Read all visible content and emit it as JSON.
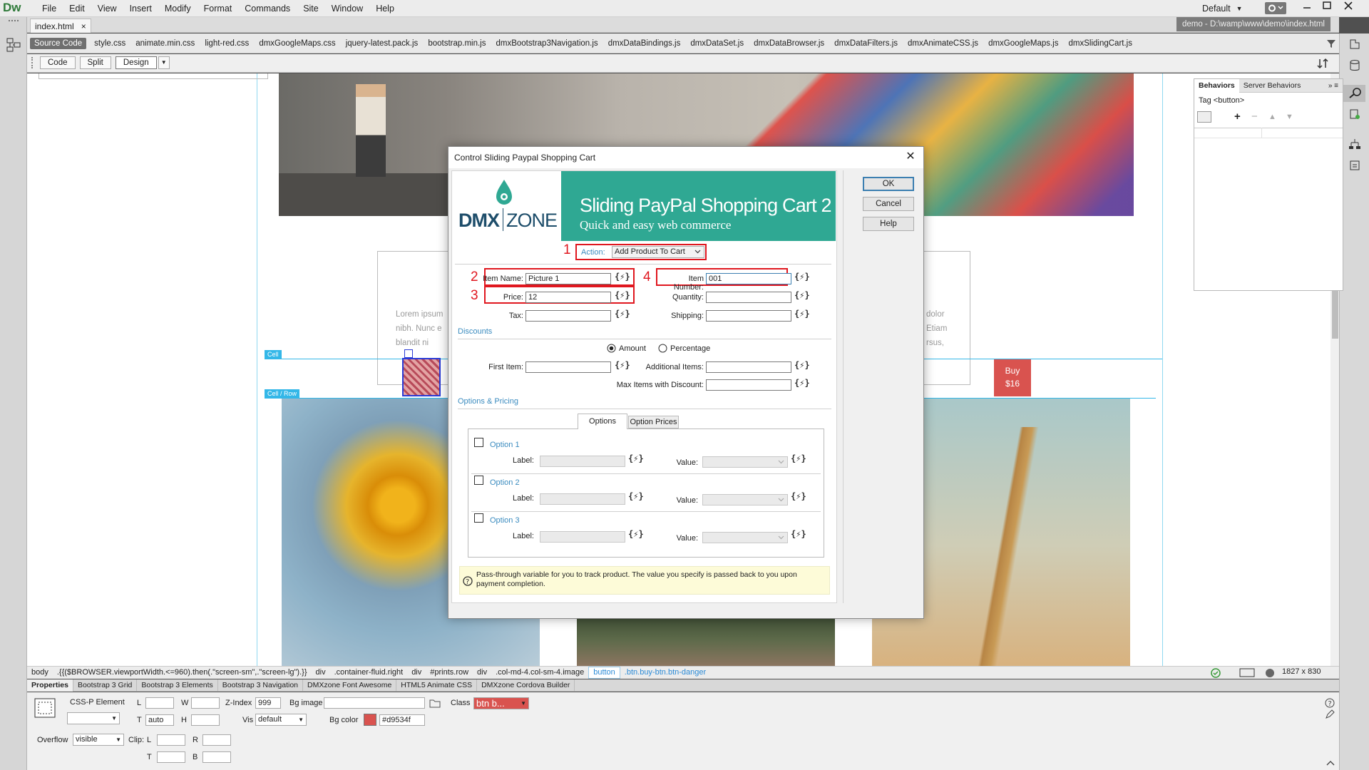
{
  "app": {
    "logo": "Dw",
    "menus": [
      "File",
      "Edit",
      "View",
      "Insert",
      "Modify",
      "Format",
      "Commands",
      "Site",
      "Window",
      "Help"
    ],
    "workspace": "Default",
    "document_path": "demo - D:\\wamp\\www\\demo\\index.html"
  },
  "doc_tab": {
    "label": "index.html",
    "close": "×"
  },
  "related_files": [
    "Source Code",
    "style.css",
    "animate.min.css",
    "light-red.css",
    "dmxGoogleMaps.css",
    "jquery-latest.pack.js",
    "bootstrap.min.js",
    "dmxBootstrap3Navigation.js",
    "dmxDataBindings.js",
    "dmxDataSet.js",
    "dmxDataBrowser.js",
    "dmxDataFilters.js",
    "dmxAnimateCSS.js",
    "dmxGoogleMaps.js",
    "dmxSlidingCart.js"
  ],
  "view_buttons": {
    "code": "Code",
    "split": "Split",
    "design": "Design"
  },
  "design": {
    "card_left_text": [
      "Lorem ipsum",
      "nibh. Nunc e",
      "blandit ni"
    ],
    "card_right_text": [
      "dolor",
      "Etiam",
      "rsus,"
    ],
    "buy_label": "Buy",
    "buy_price": "$16",
    "cell_badge": "Cell",
    "cell_row_badge": "Cell / Row"
  },
  "behaviors_panel": {
    "tabs": [
      "Behaviors",
      "Server Behaviors"
    ],
    "tag": "Tag <button>"
  },
  "status_bar": {
    "tags": [
      "body",
      ".{{($BROWSER.viewportWidth.<=960).then(.\"screen-sm\",.\"screen-lg\").}}",
      "div",
      ".container-fluid.right",
      "div",
      "#prints.row",
      "div",
      ".col-md-4.col-sm-4.image",
      "button",
      ".btn.buy-btn.btn-danger"
    ],
    "size": "1827 x 830"
  },
  "properties_tabs": [
    "Properties",
    "Bootstrap 3 Grid",
    "Bootstrap 3 Elements",
    "Bootstrap 3 Navigation",
    "DMXzone Font Awesome",
    "HTML5 Animate CSS",
    "DMXzone Cordova Builder"
  ],
  "properties": {
    "element_type": "CSS-P Element",
    "L": "L",
    "W": "W",
    "T": "T",
    "H": "H",
    "z_index_label": "Z-Index",
    "z_index": "999",
    "bg_image_label": "Bg image",
    "class_label": "Class",
    "class_value": "btn b...",
    "top_value": "auto",
    "vis_label": "Vis",
    "vis_value": "default",
    "bg_color_label": "Bg color",
    "bg_color_value": "#d9534f",
    "overflow_label": "Overflow",
    "overflow_value": "visible",
    "clip_label": "Clip:",
    "clip_L": "L",
    "clip_R": "R",
    "clip_T": "T",
    "clip_B": "B"
  },
  "dialog": {
    "title": "Control Sliding Paypal Shopping Cart",
    "close": "✕",
    "ok": "OK",
    "cancel": "Cancel",
    "help": "Help",
    "banner": {
      "logo_left": "DMX",
      "logo_right": "ZONE",
      "product": "Sliding PayPal Shopping Cart 2",
      "tagline": "Quick and easy web commerce"
    },
    "action_label": "Action:",
    "action_value": "Add Product To Cart",
    "markers": [
      "1",
      "2",
      "3",
      "4"
    ],
    "item_name_label": "Item Name:",
    "item_name_value": "Picture 1",
    "item_number_label": "Item Number:",
    "item_number_value": "001",
    "price_label": "Price:",
    "price_value": "12",
    "quantity_label": "Quantity:",
    "tax_label": "Tax:",
    "shipping_label": "Shipping:",
    "discounts_label": "Discounts",
    "amount_label": "Amount",
    "percentage_label": "Percentage",
    "first_item_label": "First Item:",
    "additional_items_label": "Additional Items:",
    "max_items_label": "Max Items with Discount:",
    "options_pricing_label": "Options & Pricing",
    "tab_options": "Options",
    "tab_option_prices": "Option Prices",
    "options": [
      {
        "name": "Option 1",
        "label": "Label:",
        "value": "Value:"
      },
      {
        "name": "Option 2",
        "label": "Label:",
        "value": "Value:"
      },
      {
        "name": "Option 3",
        "label": "Label:",
        "value": "Value:"
      }
    ],
    "dynamic_icon": "{⚡}",
    "help_icon": "?",
    "help_text": "Pass-through variable for you to track product. The value you specify is passed back to you upon payment completion."
  }
}
